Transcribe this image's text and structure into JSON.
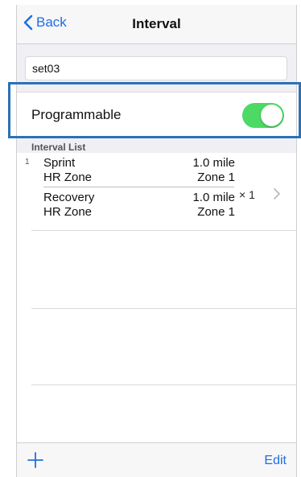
{
  "nav": {
    "back_label": "Back",
    "title": "Interval"
  },
  "name_field": {
    "value": "set03"
  },
  "programmable": {
    "label": "Programmable",
    "enabled": true,
    "accent": "#4cd964"
  },
  "list": {
    "header": "Interval List",
    "items": [
      {
        "index": "1",
        "rows": [
          {
            "name": "Sprint",
            "value": "1.0 mile"
          },
          {
            "name": "HR Zone",
            "value": "Zone 1"
          },
          {
            "name": "Recovery",
            "value": "1.0 mile"
          },
          {
            "name": "HR Zone",
            "value": "Zone 1"
          }
        ],
        "repeat": "× 1"
      }
    ]
  },
  "toolbar": {
    "add_icon": "plus-icon",
    "edit_label": "Edit"
  },
  "colors": {
    "tint": "#1f6fe0",
    "highlight": "#2a72b8"
  }
}
